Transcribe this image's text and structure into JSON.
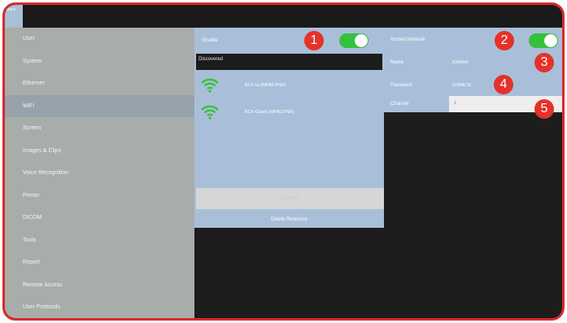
{
  "topbar": {
    "back_label": "Back"
  },
  "sidebar": {
    "items": [
      {
        "label": "User"
      },
      {
        "label": "System"
      },
      {
        "label": "Ethernet"
      },
      {
        "label": "WiFi"
      },
      {
        "label": "Screen"
      },
      {
        "label": "Images & Clips"
      },
      {
        "label": "Voice Recognition"
      },
      {
        "label": "Printer"
      },
      {
        "label": "DICOM"
      },
      {
        "label": "Tools"
      },
      {
        "label": "Report"
      },
      {
        "label": "Remote Access"
      },
      {
        "label": "User Protocols"
      }
    ],
    "active_index": 3
  },
  "wifi": {
    "enable_label": "Enable",
    "enable_on": true,
    "discovered_label": "Discovered",
    "networks": [
      {
        "name": "BCF-Ia (WPA2-PSK)"
      },
      {
        "name": "BCF-Guest (WPA2-PSK)"
      }
    ],
    "connect_label": "Connect",
    "delete_label": "Delete Resource"
  },
  "hosted": {
    "title_label": "Hosted Network",
    "enabled": true,
    "name_label": "Name",
    "name_value": "Ю5KAR",
    "password_label": "Password",
    "password_value": "COMETE",
    "channel_label": "Channel",
    "channel_value": "1"
  },
  "callouts": [
    "1",
    "2",
    "3",
    "4",
    "5"
  ],
  "colors": {
    "frame_border": "#d92a2a",
    "sidebar_bg": "#a8adaa",
    "panel_bg": "#a9bfd9",
    "toggle_on": "#34c23c",
    "wifi_icon": "#3bbf3c",
    "badge": "#e5312a"
  }
}
